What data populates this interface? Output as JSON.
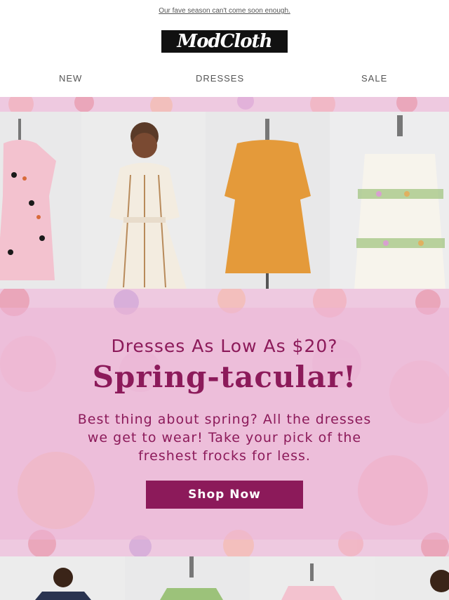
{
  "preheader": {
    "text": "Our fave season can't come soon enough."
  },
  "logo": {
    "text": "ModCloth"
  },
  "nav": {
    "items": [
      {
        "label": "NEW"
      },
      {
        "label": "DRESSES"
      },
      {
        "label": "SALE"
      }
    ]
  },
  "promo": {
    "kicker": "Dresses As Low As $20?",
    "headline": "Spring-tacular!",
    "body": "Best thing about spring? All the dresses we get to wear! Take your pick of the freshest frocks for less.",
    "cta_label": "Shop Now"
  },
  "colors": {
    "brand": "#8c1a5a",
    "banner_bg": "#eec9e0",
    "promo_panel": "#ecb4d6"
  },
  "images": {
    "top": [
      "pink-bird-print-dress-on-mannequin",
      "striped-wrap-dress-model",
      "mustard-long-sleeve-dress-on-mannequin",
      "floral-border-sundress-on-mannequin"
    ],
    "bottom": [
      "model-in-floral-top",
      "dress-on-mannequin",
      "pink-print-dress-on-mannequin",
      "model-partial"
    ]
  }
}
